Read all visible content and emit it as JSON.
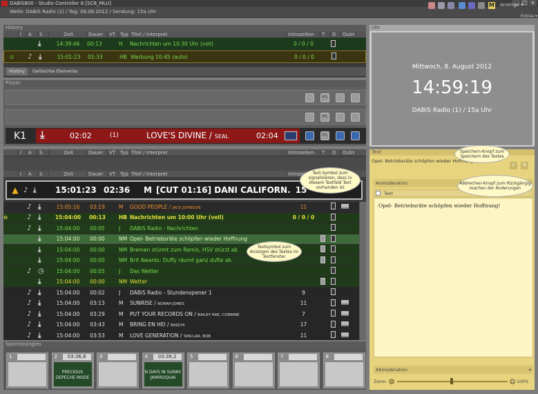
{
  "window": {
    "title": "DABiS800 - Studio Controller 8 [SC8_MLU]",
    "controls": [
      "_",
      "□",
      "×"
    ]
  },
  "infobar": {
    "text": "Welle: DABiS Radio (1) / Tag: 08.08.2012 / Sendung: 15a Uhr",
    "m_label": "M",
    "anzeige_label": "Anzeige ▾",
    "extras_label": "Extras ▾"
  },
  "history": {
    "title": "History",
    "columns": [
      "",
      "I",
      "A",
      "S",
      "Zeit",
      "Dauer",
      "VT",
      "Typ",
      "Titel / Interpret",
      "Introzeiten",
      "T",
      "D",
      "Outro"
    ],
    "rows": [
      {
        "zeit": "14:39:46",
        "dauer": "00:13",
        "typ": "H",
        "titel": "Nachrichten um 10:30 Uhr  (voll)",
        "intro": "0 / 0 / 0"
      },
      {
        "zeit": "15:01:23",
        "dauer": "01:33",
        "typ": "HB",
        "titel": "Werbung 10:45 (auto)",
        "intro": "0 / 0 / 0"
      }
    ],
    "tabs": [
      "History",
      "Gelöschte Elemente"
    ]
  },
  "player": {
    "title": "Player",
    "pfl_label": "PFL",
    "k1": {
      "label": "K1",
      "time_left": "02:02",
      "channel": "(1)",
      "title": "LOVE'S DIVINE",
      "artist": "SEAL",
      "time_right": "02:04"
    }
  },
  "playlist": {
    "columns": [
      "",
      "I",
      "A",
      "S",
      "Zeit",
      "Dauer",
      "VT",
      "Typ",
      "Titel / Interpret",
      "Introzeiten",
      "T",
      "D",
      "Outro"
    ],
    "current": {
      "zeit": "15:01:23",
      "dauer": "02:36",
      "typ": "M",
      "titel": "[CUT 01:16] DANI CALIFORN...",
      "intro": "15"
    },
    "rows": [
      {
        "zeit": "15:05:16",
        "dauer": "03:19",
        "typ": "M",
        "titel": "GOOD PEOPLE",
        "artist": "JACK JOHNSON",
        "intro": "11",
        "style": "orange"
      },
      {
        "zeit": "15:04:00",
        "dauer": "00:13",
        "typ": "HB",
        "titel": "Nachrichten um 10:00 Uhr  (voll)",
        "artist": "",
        "intro": "0 / 0 / 0",
        "style": "yellowbold"
      },
      {
        "zeit": "15:04:00",
        "dauer": "00:05",
        "typ": "J",
        "titel": "DABiS Radio - Nachrichten",
        "artist": "",
        "intro": "",
        "style": "green"
      },
      {
        "zeit": "15:04:00",
        "dauer": "00:00",
        "typ": "NM",
        "titel": "Opel- Betriebsräte schöpfen wieder Hoffnung",
        "artist": "",
        "intro": "",
        "style": "greensel"
      },
      {
        "zeit": "15:04:00",
        "dauer": "00:00",
        "typ": "NM",
        "titel": "Bremen stürmt zum Remis, HSV stürzt ab",
        "artist": "",
        "intro": "",
        "style": "green"
      },
      {
        "zeit": "15:04:00",
        "dauer": "00:00",
        "typ": "NM",
        "titel": "Brit Awards: Duffy räumt ganz dufte ab",
        "artist": "",
        "intro": "",
        "style": "green"
      },
      {
        "zeit": "15:04:00",
        "dauer": "00:05",
        "typ": "J",
        "titel": "Das Wetter",
        "artist": "",
        "intro": "",
        "style": "green"
      },
      {
        "zeit": "15:04:00",
        "dauer": "00:00",
        "typ": "NM",
        "titel": "Wetter",
        "artist": "",
        "intro": "",
        "style": "greenyellow"
      },
      {
        "zeit": "15:04:00",
        "dauer": "00:02",
        "typ": "J",
        "titel": "DABiS Radio - Stundenopener 1",
        "artist": "",
        "intro": "9",
        "style": "dark"
      },
      {
        "zeit": "15:04:00",
        "dauer": "03:13",
        "typ": "M",
        "titel": "SUNRISE",
        "artist": "NORAH JONES",
        "intro": "11",
        "style": "dark"
      },
      {
        "zeit": "15:04:00",
        "dauer": "03:29",
        "typ": "M",
        "titel": "PUT YOUR RECORDS ON",
        "artist": "BAILEY RAE, CORINNE",
        "intro": "7",
        "style": "dark"
      },
      {
        "zeit": "15:04:00",
        "dauer": "03:43",
        "typ": "M",
        "titel": "BRING EN HEI",
        "artist": "BASCHI",
        "intro": "17",
        "style": "dark"
      },
      {
        "zeit": "15:04:00",
        "dauer": "03:53",
        "typ": "M",
        "titel": "LOVE GENERATION",
        "artist": "SINCLAR, BOB",
        "intro": "11",
        "style": "dark"
      }
    ]
  },
  "spontanjingles": {
    "title": "Spontanjingles",
    "slots": [
      {
        "num": "1",
        "time": "",
        "title": "",
        "artist": ""
      },
      {
        "num": "2",
        "time": "03:36,8",
        "title": "PRECIOUS",
        "artist": "DEPECHE MODE"
      },
      {
        "num": "3",
        "time": "",
        "title": "",
        "artist": ""
      },
      {
        "num": "4",
        "time": "03:39,2",
        "title": "N DAYS IN SUNNY",
        "artist": "JAMIROQUAI"
      },
      {
        "num": "5",
        "time": "",
        "title": "",
        "artist": ""
      },
      {
        "num": "6",
        "time": "",
        "title": "",
        "artist": ""
      },
      {
        "num": "7",
        "time": "",
        "title": "",
        "artist": ""
      },
      {
        "num": "8",
        "time": "",
        "title": "",
        "artist": ""
      }
    ]
  },
  "uhr": {
    "title": "Uhr",
    "date": "Mittwoch, 8. August 2012",
    "time": "14:59:19",
    "station": "DABiS Radio (1) / 15a Uhr"
  },
  "textpanel": {
    "title": "Text",
    "subject": "Opel- Betriebsräte schöpfen wieder Hoffnung",
    "anmoderation": "Anmoderation",
    "text_label": "Text",
    "body": "Opel- Betriebsräte schöpfen wieder Hoffnung!",
    "abmoderation": "Abmoderation",
    "zoom_label": "Zoom:",
    "zoom_value": "100%"
  },
  "callouts": {
    "textsymbol": "Text-Symbol zum signalisieren, dass in diesem Textfeld Text vorhanden ist",
    "speichern": "Speichern-Knopf zum Speichern des Textes",
    "abbrechen": "Abbrechen-Knopf zum Rückgängig machen der Änderungen",
    "anzeigen": "Textsymbol zum Anzeigen des Textes im Textfenster"
  },
  "colors": {
    "accent_green": "#7ddc52",
    "accent_orange": "#f0902a",
    "accent_yellow": "#e8e040",
    "current_bg": "#222222",
    "text_panel": "#e8d47e"
  }
}
